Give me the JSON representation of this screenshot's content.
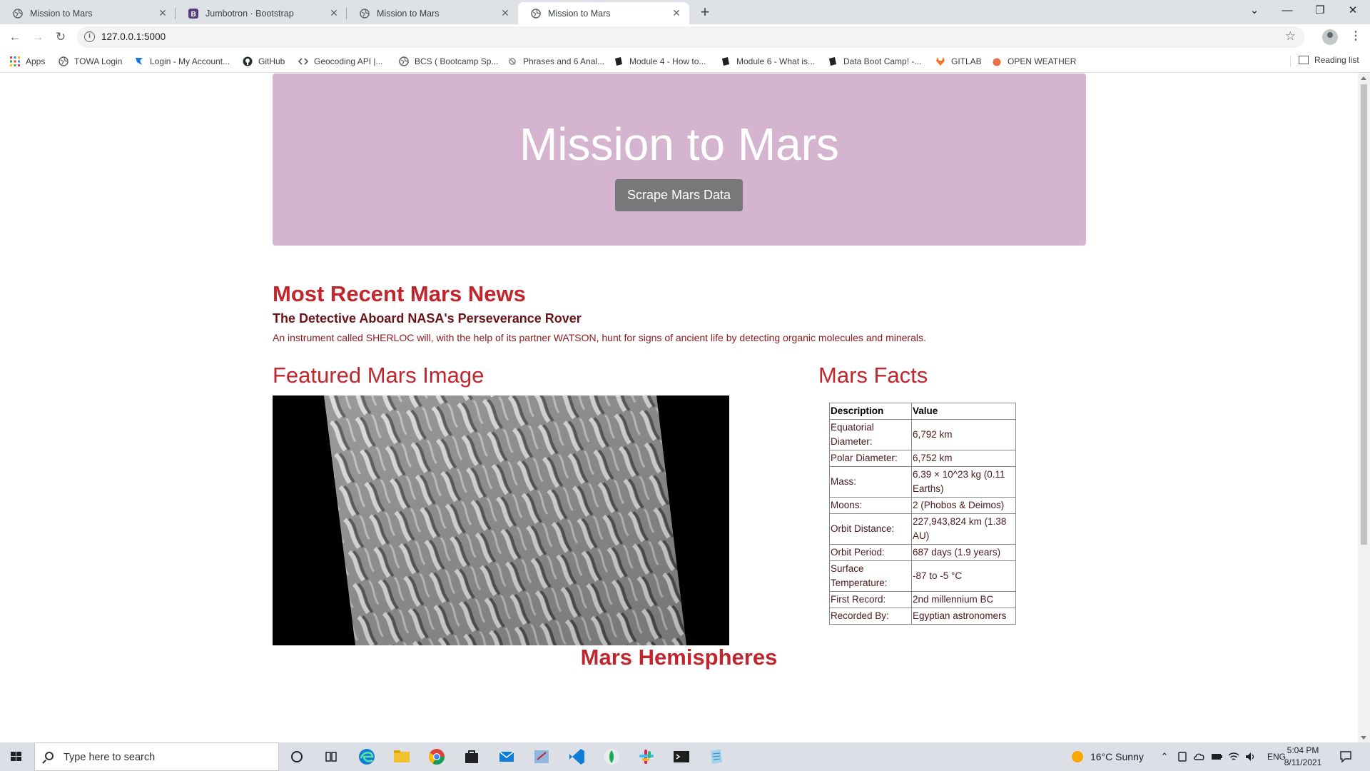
{
  "browser": {
    "tabs": [
      {
        "title": "Mission to Mars",
        "active": false
      },
      {
        "title": "Jumbotron · Bootstrap",
        "active": false
      },
      {
        "title": "Mission to Mars",
        "active": false
      },
      {
        "title": "Mission to Mars",
        "active": true
      }
    ],
    "new_tab": "+",
    "url": "127.0.0.1:5000",
    "bookmarks": [
      {
        "label": "Apps",
        "icon": "apps-grid-icon"
      },
      {
        "label": "TOWA Login",
        "icon": "globe-icon"
      },
      {
        "label": "Login - My Account...",
        "icon": "login-icon"
      },
      {
        "label": "GitHub",
        "icon": "github-icon"
      },
      {
        "label": "Geocoding API |...",
        "icon": "code-icon"
      },
      {
        "label": "BCS ( Bootcamp Sp...",
        "icon": "globe-icon"
      },
      {
        "label": "Phrases and 6 Anal...",
        "icon": "phrases-icon"
      },
      {
        "label": "Module 4 - How to...",
        "icon": "book-icon"
      },
      {
        "label": "Module 6 - What is...",
        "icon": "book-icon"
      },
      {
        "label": "Data Boot Camp! -...",
        "icon": "book-icon"
      },
      {
        "label": "GITLAB",
        "icon": "gitlab-icon"
      },
      {
        "label": "OPEN WEATHER",
        "icon": "weather-icon"
      }
    ],
    "reading_list": "Reading list"
  },
  "page": {
    "jumbotron_title": "Mission to Mars",
    "scrape_button": "Scrape Mars Data",
    "news_heading": "Most Recent Mars News",
    "news_title": "The Detective Aboard NASA's Perseverance Rover",
    "news_paragraph": "An instrument called SHERLOC will, with the help of its partner WATSON, hunt for signs of ancient life by detecting organic molecules and minerals.",
    "featured_heading": "Featured Mars Image",
    "facts_heading": "Mars Facts",
    "facts_headers": [
      "Description",
      "Value"
    ],
    "facts": [
      [
        "Equatorial Diameter:",
        "6,792 km"
      ],
      [
        "Polar Diameter:",
        "6,752 km"
      ],
      [
        "Mass:",
        "6.39 × 10^23 kg (0.11 Earths)"
      ],
      [
        "Moons:",
        "2 (Phobos & Deimos)"
      ],
      [
        "Orbit Distance:",
        "227,943,824 km (1.38 AU)"
      ],
      [
        "Orbit Period:",
        "687 days (1.9 years)"
      ],
      [
        "Surface Temperature:",
        "-87 to -5 °C"
      ],
      [
        "First Record:",
        "2nd millennium BC"
      ],
      [
        "Recorded By:",
        "Egyptian astronomers"
      ]
    ],
    "hemispheres_heading": "Mars Hemispheres"
  },
  "taskbar": {
    "search_placeholder": "Type here to search",
    "weather": "16°C  Sunny",
    "language": "ENG",
    "time": "5:04 PM",
    "date": "8/11/2021"
  },
  "colors": {
    "jumbotron": "#d4b4cf",
    "heading_red": "#c0262d",
    "button_gray": "#78787a"
  }
}
